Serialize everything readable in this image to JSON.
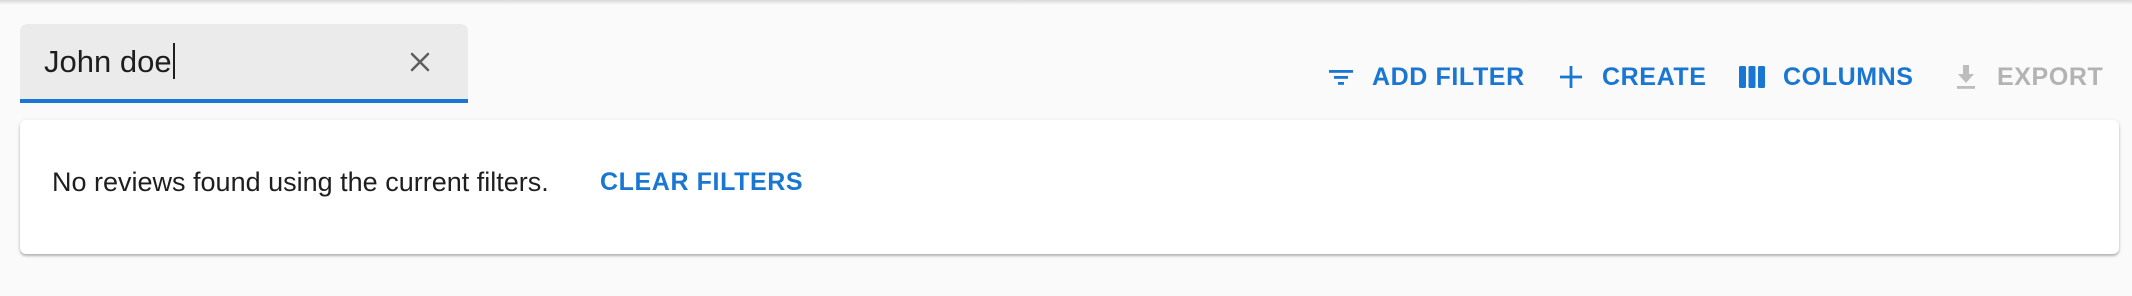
{
  "search": {
    "value": "John doe"
  },
  "toolbar": {
    "add_filter_label": "ADD FILTER",
    "create_label": "CREATE",
    "columns_label": "COLUMNS",
    "export_label": "EXPORT",
    "export_disabled": true
  },
  "empty_state": {
    "message": "No reviews found using the current filters.",
    "clear_filters_label": "CLEAR FILTERS"
  },
  "colors": {
    "accent": "#1976d2",
    "disabled": "#b3b3b3",
    "background": "#fafafa",
    "text": "#1e1e1e"
  },
  "icons": {
    "clear": "close-icon",
    "add_filter": "filter-list-icon",
    "create": "add-icon",
    "columns": "view-column-icon",
    "export": "download-icon"
  }
}
